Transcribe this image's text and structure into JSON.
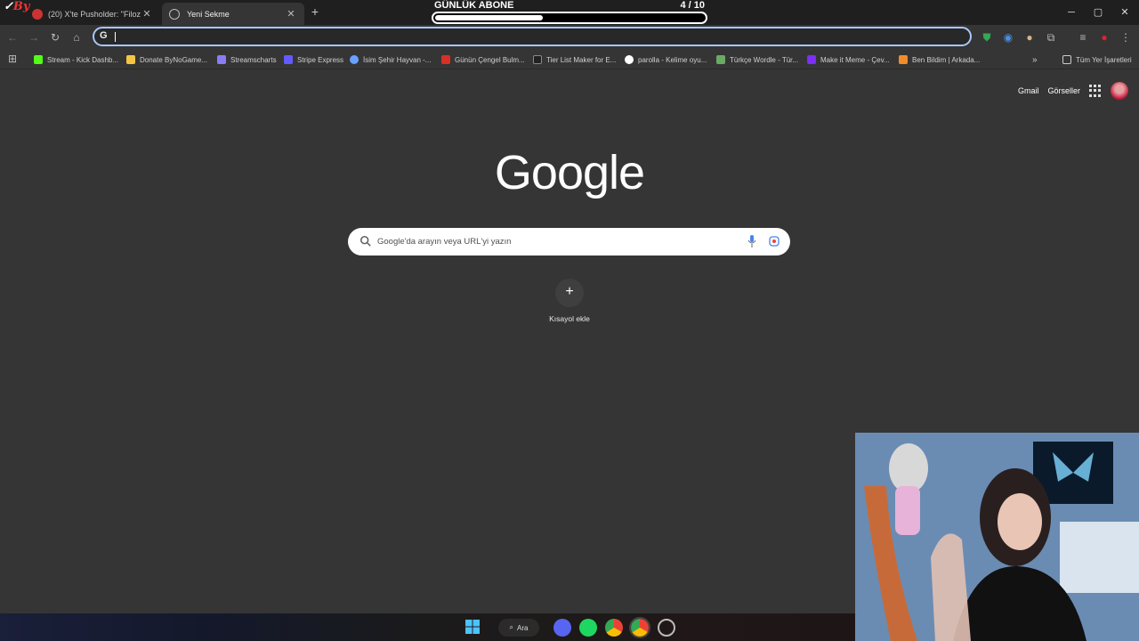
{
  "tabs": [
    {
      "title": "(20) X'te Pusholder: \"Filozof At...",
      "close": "✕"
    },
    {
      "title": "Yeni Sekme",
      "close": "✕"
    }
  ],
  "new_tab": "+",
  "overlay": {
    "logo_text": "By",
    "sub_goal_label": "GÜNLÜK ABONE",
    "sub_goal_count": "4  / 10",
    "sub_goal_progress": 0.4
  },
  "window_controls": {
    "minimize": "─",
    "maximize": "▢",
    "close": "✕"
  },
  "omnibox": {
    "value": "",
    "icon": "G"
  },
  "bookmarks": [
    {
      "label": "Stream - Kick Dashb...",
      "color": "#53fc18"
    },
    {
      "label": "Donate ByNoGame...",
      "color": "#f4c542"
    },
    {
      "label": "Streamscharts",
      "color": "#8b7cf6"
    },
    {
      "label": "Stripe Express",
      "color": "#635bff"
    },
    {
      "label": "İsim Şehir Hayvan -...",
      "color": "#6aa0ff"
    },
    {
      "label": "Günün Çengel Bulm...",
      "color": "#d93025"
    },
    {
      "label": "Tier List Maker for E...",
      "color": "#222222"
    },
    {
      "label": "parolla - Kelime oyu...",
      "color": "#ffffff"
    },
    {
      "label": "Türkçe Wordle - Tür...",
      "color": "#6aaa64"
    },
    {
      "label": "Make it Meme - Çev...",
      "color": "#7b2ff7"
    },
    {
      "label": "Ben Bildim | Arkada...",
      "color": "#f28c28"
    }
  ],
  "all_bookmarks": "Tüm Yer İşaretleri",
  "ntp": {
    "gmail": "Gmail",
    "images": "Görseller",
    "logo": "Google",
    "search_placeholder": "Google'da arayın veya URL'yi yazın",
    "add_shortcut": "Kısayol ekle"
  },
  "taskbar": {
    "search_label": "Ara"
  }
}
